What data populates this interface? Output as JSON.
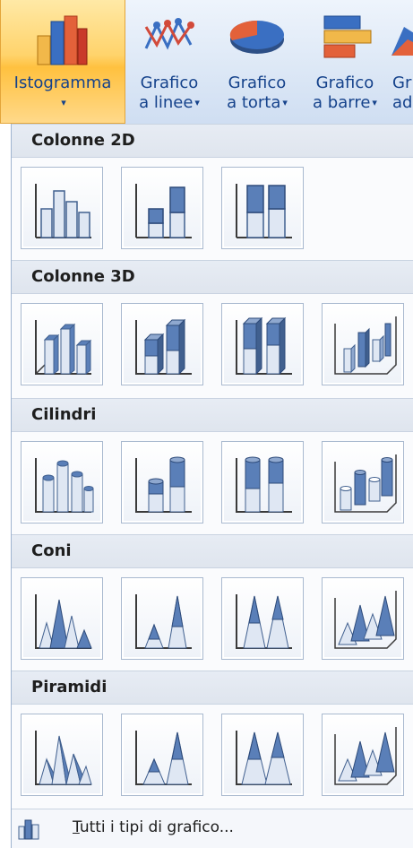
{
  "ribbon": {
    "buttons": [
      {
        "line1": "Istogramma",
        "line2": "",
        "icon": "column-chart-icon",
        "active": true
      },
      {
        "line1": "Grafico",
        "line2": "a linee",
        "icon": "line-chart-icon"
      },
      {
        "line1": "Grafico",
        "line2": "a torta",
        "icon": "pie-chart-icon"
      },
      {
        "line1": "Grafico",
        "line2": "a barre",
        "icon": "bar-chart-icon"
      },
      {
        "line1": "Gr",
        "line2": "ad",
        "icon": "area-chart-icon"
      }
    ],
    "dropdown_caret": "▾"
  },
  "gallery": {
    "sections": [
      {
        "title": "Colonne 2D",
        "icons": [
          "clustered-column-icon",
          "stacked-column-icon",
          "100-stacked-column-icon"
        ]
      },
      {
        "title": "Colonne 3D",
        "icons": [
          "3d-clustered-column-icon",
          "3d-stacked-column-icon",
          "3d-100-stacked-column-icon",
          "3d-column-icon"
        ]
      },
      {
        "title": "Cilindri",
        "icons": [
          "clustered-cylinder-icon",
          "stacked-cylinder-icon",
          "100-stacked-cylinder-icon",
          "3d-cylinder-icon"
        ]
      },
      {
        "title": "Coni",
        "icons": [
          "clustered-cone-icon",
          "stacked-cone-icon",
          "100-stacked-cone-icon",
          "3d-cone-icon"
        ]
      },
      {
        "title": "Piramidi",
        "icons": [
          "clustered-pyramid-icon",
          "stacked-pyramid-icon",
          "100-stacked-pyramid-icon",
          "3d-pyramid-icon"
        ]
      }
    ],
    "footer_accel": "T",
    "footer_rest": "utti i tipi di grafico...",
    "footer_icon": "all-chart-types-icon"
  },
  "colors": {
    "accent_active": "#ffc13f",
    "ribbon_text": "#15428b",
    "column_blue": "#5a7fb8",
    "column_light": "#dfe7f3"
  }
}
